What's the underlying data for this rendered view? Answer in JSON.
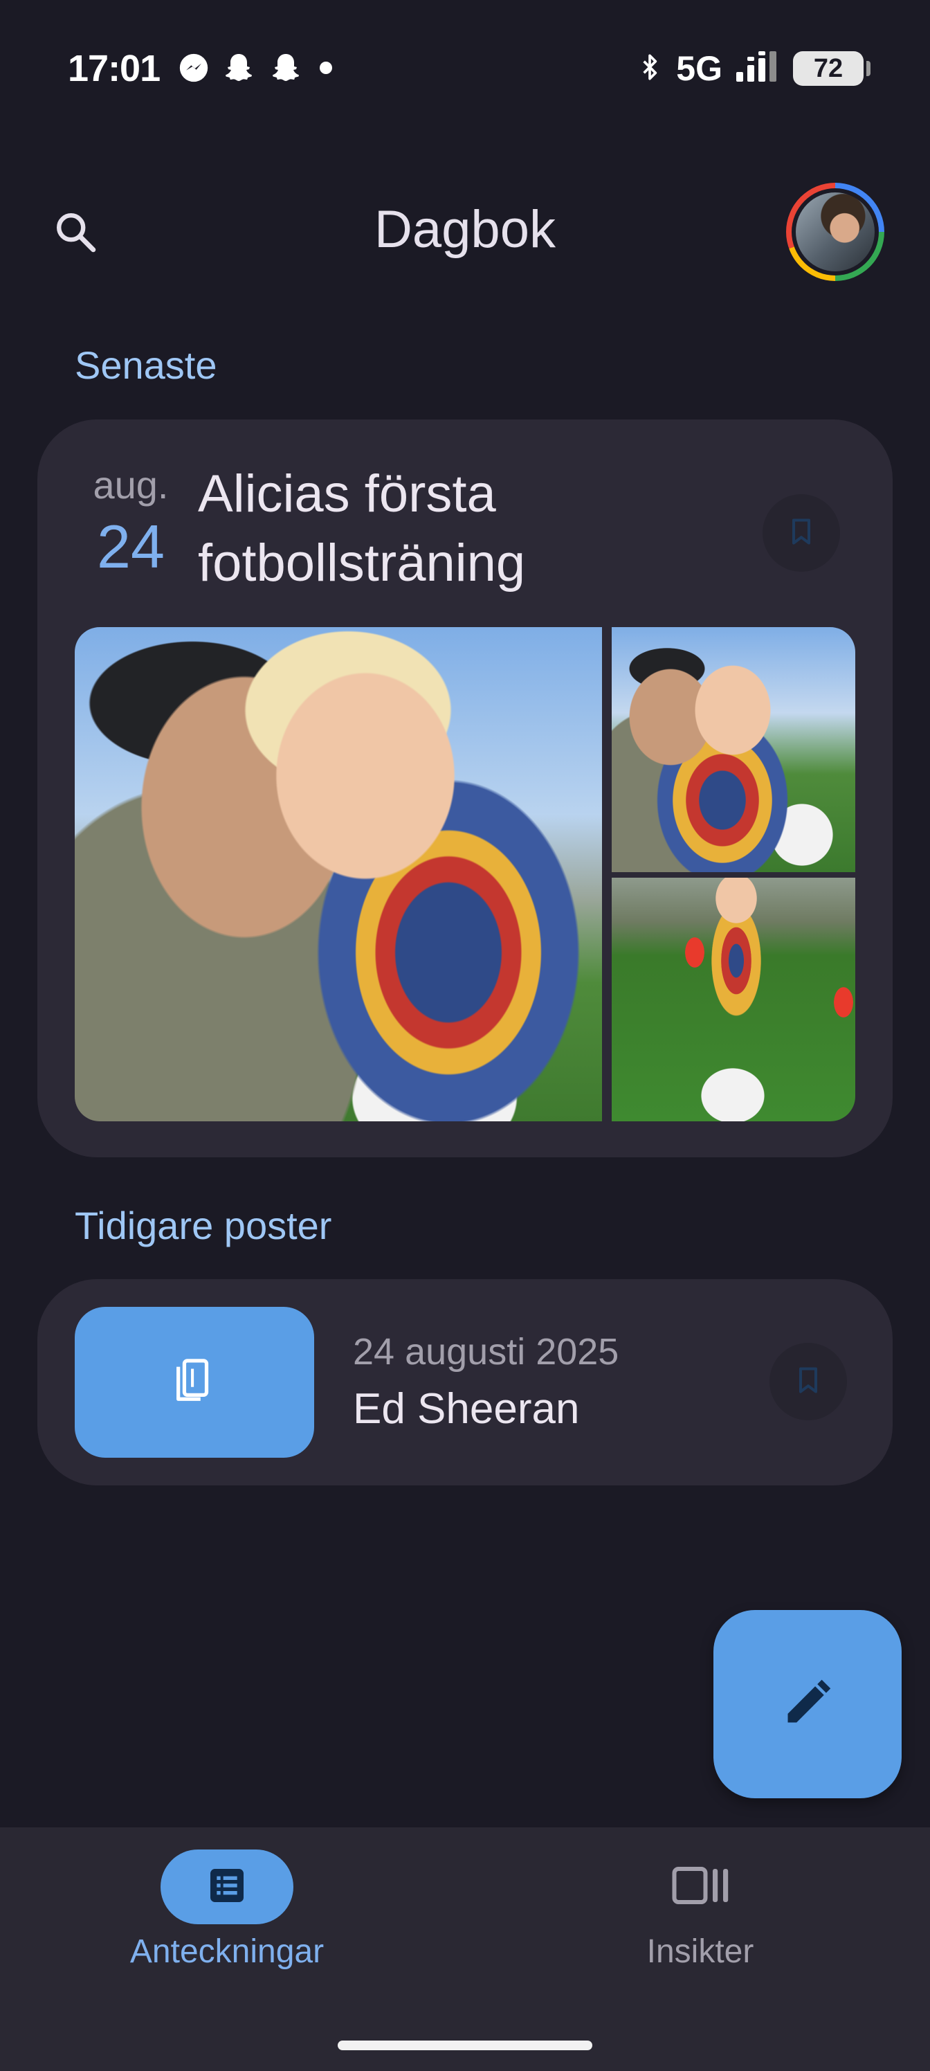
{
  "status_bar": {
    "time": "17:01",
    "network": "5G",
    "battery_level": "72",
    "icons": [
      "messenger-icon",
      "snapchat-icon",
      "snapchat-icon",
      "dot-icon",
      "bluetooth-icon",
      "signal-icon"
    ]
  },
  "app_bar": {
    "title": "Dagbok",
    "search_icon": "search-icon",
    "avatar": "account-avatar"
  },
  "latest": {
    "section_label": "Senaste",
    "entry": {
      "month": "aug.",
      "day": "24",
      "title": "Alicias första fotbollsträning",
      "bookmark_icon": "bookmark-icon"
    }
  },
  "earlier": {
    "section_label": "Tidigare poster",
    "entries": [
      {
        "date": "24 augusti 2025",
        "title": "Ed Sheeran",
        "thumb_icon": "book-icon",
        "bookmark_icon": "bookmark-icon"
      }
    ]
  },
  "fab": {
    "icon": "edit-icon"
  },
  "bottom_nav": {
    "items": [
      {
        "label": "Anteckningar",
        "icon": "list-icon",
        "active": true
      },
      {
        "label": "Insikter",
        "icon": "insights-icon",
        "active": false
      }
    ]
  },
  "colors": {
    "background": "#1b1a25",
    "card": "#2c2936",
    "accent": "#5a9ee6",
    "accent_text": "#9fc7f5"
  }
}
